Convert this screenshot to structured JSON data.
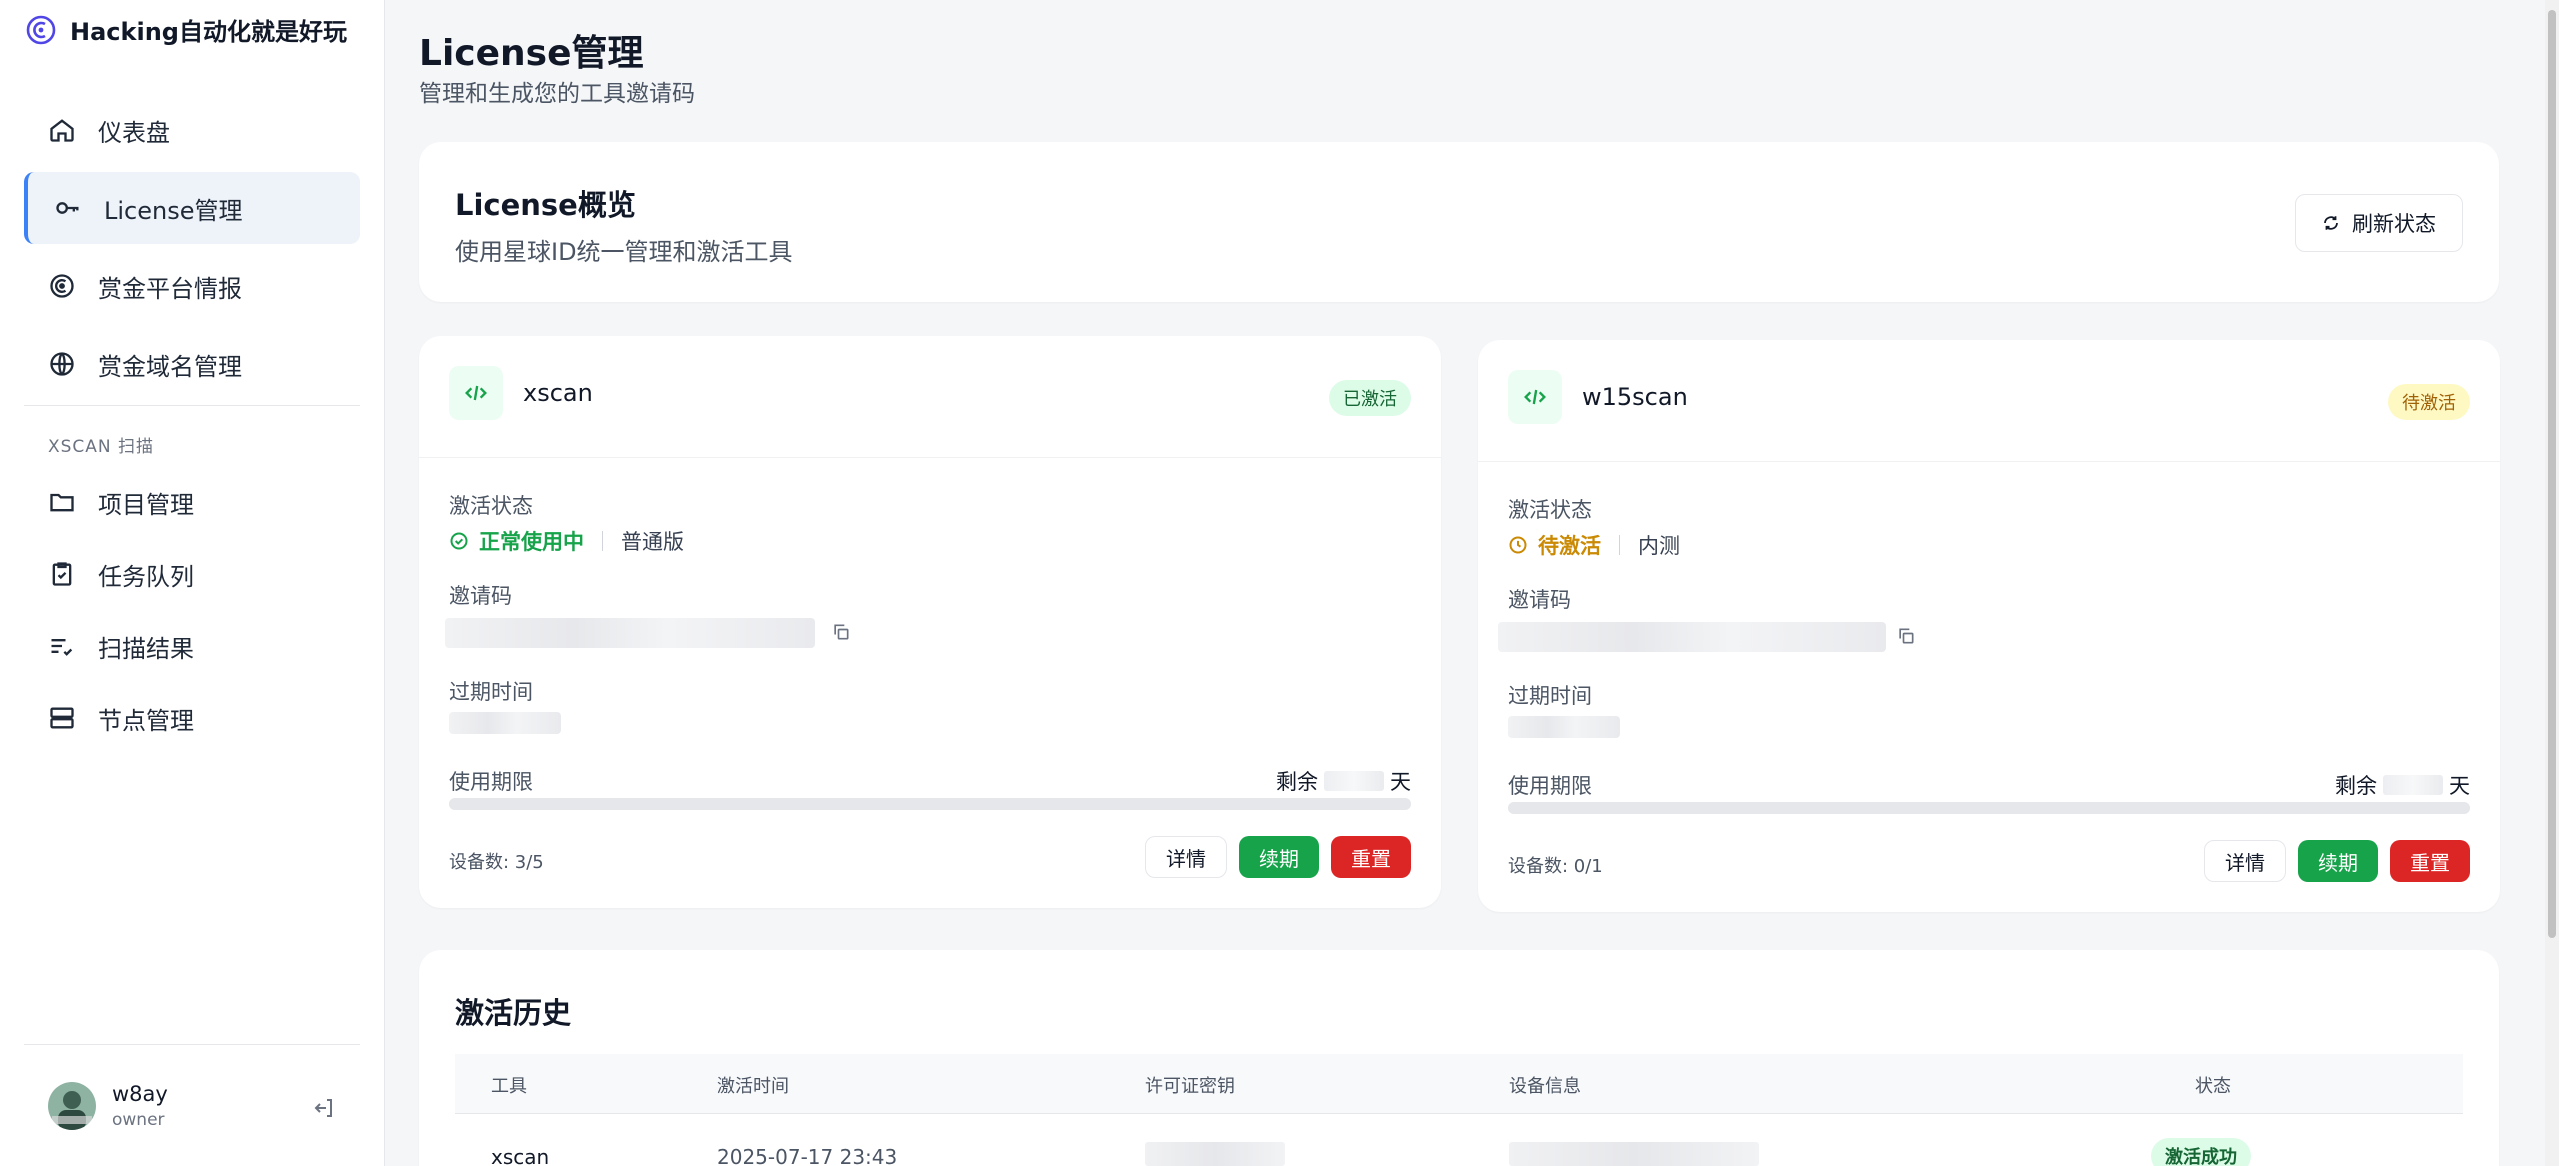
{
  "brand": {
    "title": "Hacking自动化就是好玩"
  },
  "nav": {
    "items": [
      {
        "label": "仪表盘",
        "icon": "home-icon"
      },
      {
        "label": "License管理",
        "icon": "key-icon"
      },
      {
        "label": "赏金平台情报",
        "icon": "radar-icon"
      },
      {
        "label": "赏金域名管理",
        "icon": "globe-icon"
      }
    ],
    "section_label": "XSCAN 扫描",
    "scan_items": [
      {
        "label": "项目管理",
        "icon": "folder-icon"
      },
      {
        "label": "任务队列",
        "icon": "clipboard-check-icon"
      },
      {
        "label": "扫描结果",
        "icon": "list-check-icon"
      },
      {
        "label": "节点管理",
        "icon": "server-icon"
      }
    ]
  },
  "user": {
    "name": "w8ay",
    "role": "owner"
  },
  "page": {
    "title": "License管理",
    "subtitle": "管理和生成您的工具邀请码"
  },
  "overview": {
    "title": "License概览",
    "subtitle": "使用星球ID统一管理和激活工具",
    "refresh_label": "刷新状态"
  },
  "labels": {
    "activation_status": "激活状态",
    "invite_code": "邀请码",
    "expire_time": "过期时间",
    "usage_period": "使用期限",
    "remaining_prefix": "剩余",
    "remaining_suffix": "天",
    "detail": "详情",
    "renew": "续期",
    "reset": "重置"
  },
  "tools": [
    {
      "name": "xscan",
      "badge": "已激活",
      "status": "正常使用中",
      "status_color": "#16a34a",
      "plan": "普通版",
      "devices": "设备数: 3/5"
    },
    {
      "name": "w15scan",
      "badge": "待激活",
      "status": "待激活",
      "status_color": "#ca8a04",
      "plan": "内测",
      "devices": "设备数: 0/1"
    }
  ],
  "history": {
    "title": "激活历史",
    "columns": [
      "工具",
      "激活时间",
      "许可证密钥",
      "设备信息",
      "状态"
    ],
    "rows": [
      {
        "tool": "xscan",
        "time": "2025-07-17 23:43",
        "status": "激活成功"
      }
    ]
  },
  "colors": {
    "accent": "#3b82f6",
    "success": "#16a34a",
    "danger": "#dc2626",
    "warning": "#ca8a04"
  }
}
